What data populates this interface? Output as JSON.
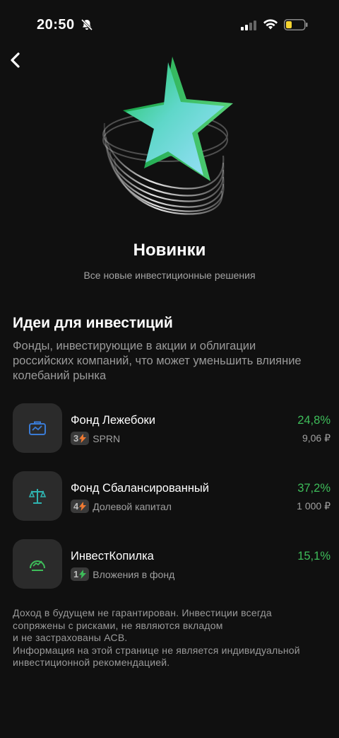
{
  "status_bar": {
    "time": "20:50"
  },
  "header": {
    "title": "Новинки",
    "subtitle": "Все новые инвестиционные решения"
  },
  "section": {
    "title": "Идеи для инвестиций",
    "description": "Фонды, инвестирующие в акции и облигации российских компаний, что может уменьшить влияние колебаний рынка"
  },
  "funds": [
    {
      "name": "Фонд Лежебоки",
      "risk": "3",
      "bolt_color": "#f07a32",
      "meta": "SPRN",
      "return": "24,8%",
      "price": "9,06 ₽",
      "icon": "briefcase-icon",
      "icon_color": "#3a7bd5"
    },
    {
      "name": "Фонд Сбалансированный",
      "risk": "4",
      "bolt_color": "#f07a32",
      "meta": "Долевой капитал",
      "return": "37,2%",
      "price": "1 000 ₽",
      "icon": "scales-icon",
      "icon_color": "#2fb3b0"
    },
    {
      "name": "ИнвестКопилка",
      "risk": "1",
      "bolt_color": "#3ebd5a",
      "meta": "Вложения в фонд",
      "return": "15,1%",
      "price": "",
      "icon": "gauge-icon",
      "icon_color": "#3ebd5a"
    }
  ],
  "disclaimer": {
    "line1": "Доход в будущем не гарантирован. Инвестиции всегда",
    "line2": "сопряжены с рисками, не являются вкладом",
    "line3": "и не застрахованы АСВ.",
    "line4": "Информация на этой странице не является индивидуальной",
    "line5": "инвестиционной рекомендацией."
  },
  "colors": {
    "background": "#101010",
    "accent_green": "#3ebd5a",
    "muted_text": "#9a9a9a"
  }
}
